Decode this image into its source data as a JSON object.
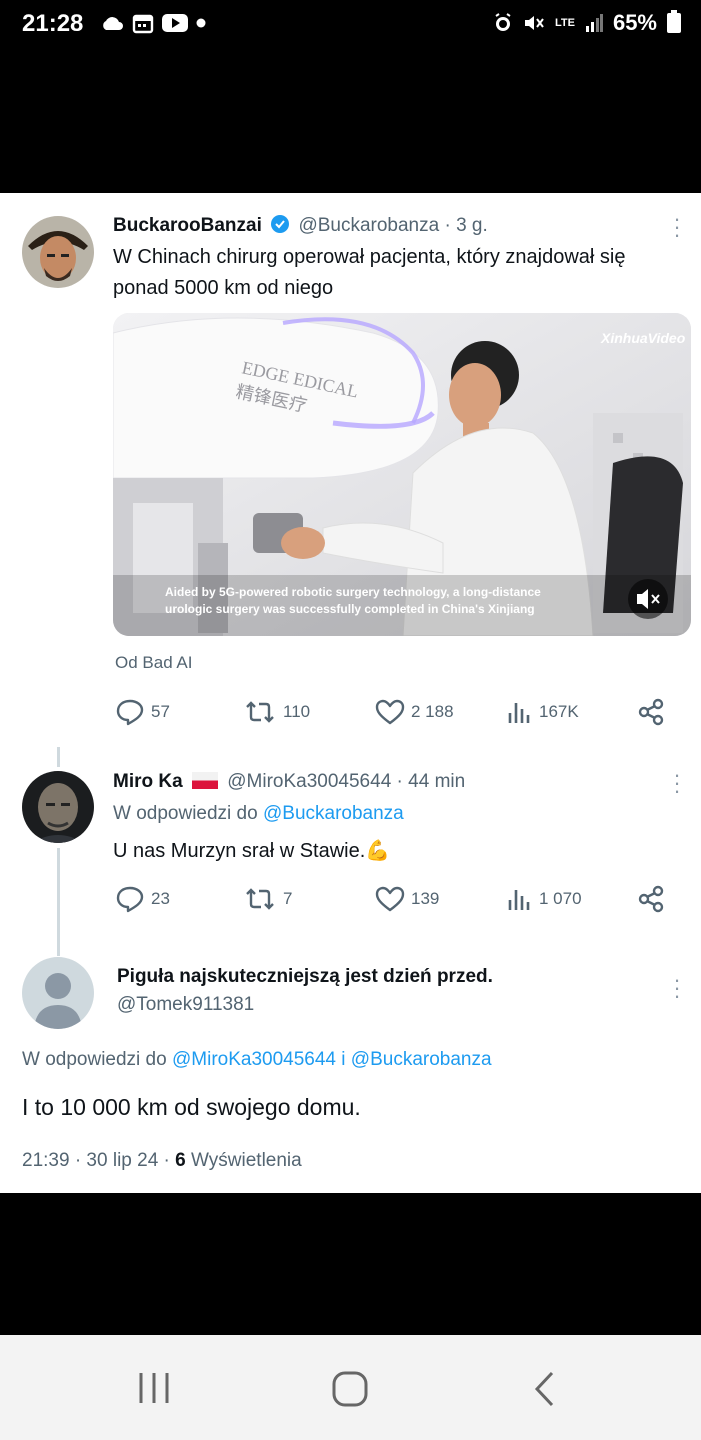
{
  "status_bar": {
    "time": "21:28",
    "network": "LTE",
    "battery": "65%"
  },
  "tweet": {
    "name": "BuckarooBanzai",
    "handle": "@Buckarobanza",
    "time": "· 3 g.",
    "text_line1": "W Chinach chirurg operował pacjenta, który znajdował się",
    "text_line2": "ponad 5000 km od niego",
    "media": {
      "watermark": "XinhuaVideo",
      "sign_line1": "EDGE  EDICAL",
      "sign_line2": "精锋医疗",
      "caption_line1": "Aided by 5G-powered robotic surgery technology, a long-distance",
      "caption_line2": "urologic surgery was successfully completed in China's Xinjiang"
    },
    "source": "Od Bad AI",
    "stats": {
      "replies": "57",
      "reposts": "110",
      "likes": "2 188",
      "views": "167K"
    }
  },
  "reply1": {
    "name": "Miro Ka",
    "handle": "@MiroKa30045644",
    "time": "· 44 min",
    "reply_prefix": "W odpowiedzi do",
    "reply_handle": "@Buckarobanza",
    "text": "U nas Murzyn srał w Stawie.💪",
    "stats": {
      "replies": "23",
      "reposts": "7",
      "likes": "139",
      "views": "1 070"
    }
  },
  "reply2": {
    "name": "Piguła najskuteczniejszą jest dzień przed.",
    "handle": "@Tomek911381",
    "reply_prefix": "W odpowiedzi do",
    "reply_handle1": "@MiroKa30045644",
    "reply_joiner": "i",
    "reply_handle2": "@Buckarobanza",
    "text": "I to 10 000 km od swojego domu.",
    "timestamp": "21:39 · 30 lip 24 ·",
    "views_count": "6",
    "views_label": "Wyświetlenia"
  },
  "colors": {
    "accent": "#1d9bf0",
    "muted": "#536471",
    "text": "#0f1419"
  },
  "icons": [
    "cloud-icon",
    "calendar-icon",
    "youtube-icon",
    "alarm-icon",
    "mute-icon",
    "signal-icon",
    "battery-icon",
    "verified-badge-icon",
    "more-icon",
    "reply-icon",
    "repost-icon",
    "like-icon",
    "views-icon",
    "share-icon",
    "mute-video-icon",
    "recents-icon",
    "home-icon",
    "back-icon"
  ]
}
